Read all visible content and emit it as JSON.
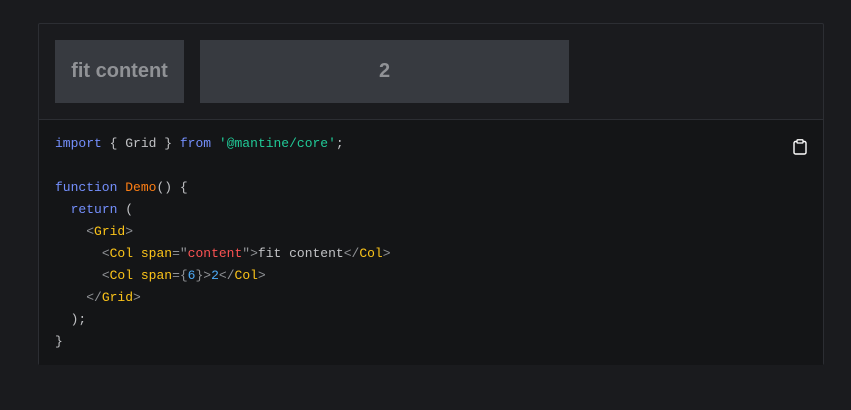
{
  "preview": {
    "col1_label": "fit content",
    "col2_label": "2"
  },
  "code": {
    "import_kw": "import",
    "import_names": "{ Grid }",
    "from_kw": "from",
    "module": "'@mantine/core'",
    "semicolon": ";",
    "function_kw": "function",
    "fn_name": "Demo",
    "fn_sig_rest": "() {",
    "return_kw": "return",
    "return_open": " (",
    "grid_open_lt": "<",
    "grid_tag": "Grid",
    "grid_open_gt": ">",
    "col1_lt": "<",
    "col1_tag": "Col",
    "col1_attr": "span",
    "col1_eq": "=\"",
    "col1_value": "content",
    "col1_close_quote": "\">",
    "col1_text": "fit content",
    "col1_end_lt": "</",
    "col1_end_tag": "Col",
    "col1_end_gt": ">",
    "col2_lt": "<",
    "col2_tag": "Col",
    "col2_attr": "span",
    "col2_eq": "={",
    "col2_value": "6",
    "col2_close": "}>",
    "col2_text": "2",
    "col2_end_lt": "</",
    "col2_end_tag": "Col",
    "col2_end_gt": ">",
    "grid_close_lt": "</",
    "grid_close_tag": "Grid",
    "grid_close_gt": ">",
    "return_close": ");",
    "fn_close": "}"
  },
  "icons": {
    "copy": "clipboard-icon"
  },
  "colors": {
    "background": "#1a1b1e",
    "code_background": "#141517",
    "col_background": "#373a40",
    "keyword": "#748ffc",
    "string": "#20c997",
    "function": "#fd7e14",
    "tag": "#fcc419",
    "attr_string": "#fa5252",
    "number": "#4dabf7"
  }
}
